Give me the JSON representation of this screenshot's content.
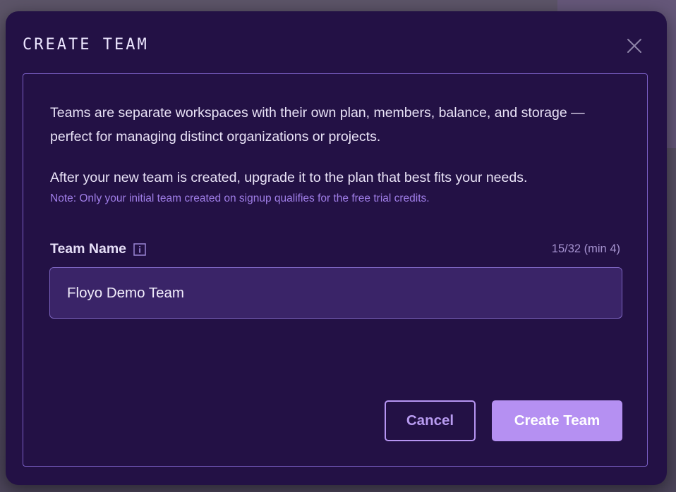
{
  "modal": {
    "title": "CREATE TEAM",
    "close_icon": "close-icon",
    "description": "Teams are separate workspaces with their own plan, members, balance, and storage — perfect for managing distinct organizations or projects.",
    "upgrade_text": "After your new team is created, upgrade it to the plan that best fits your needs.",
    "note": "Note: Only your initial team created on signup qualifies for the free trial credits.",
    "field": {
      "label": "Team Name",
      "info_icon": "info-icon",
      "char_count": "15/32 (min 4)",
      "value": "Floyo Demo Team"
    },
    "buttons": {
      "cancel": "Cancel",
      "create": "Create Team"
    }
  },
  "colors": {
    "modal_bg": "#231145",
    "accent": "#b590f2",
    "note_text": "#a07ee8",
    "border": "#7a5fc4"
  }
}
